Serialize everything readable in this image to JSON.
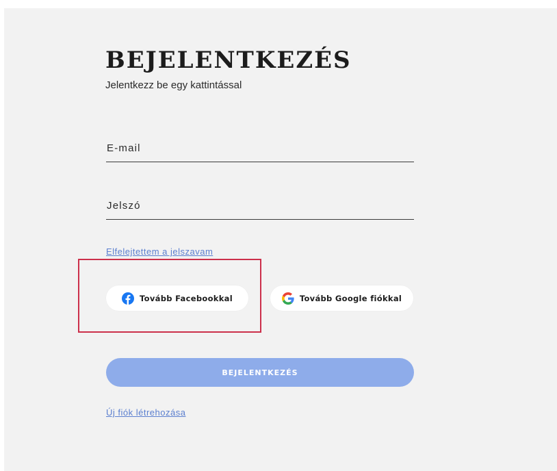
{
  "login": {
    "title": "BEJELENTKEZÉS",
    "subtitle": "Jelentkezz be egy kattintással",
    "email_placeholder": "E-mail",
    "password_placeholder": "Jelszó",
    "forgot_password": "Elfelejtettem a jelszavam",
    "facebook_button": "Tovább Facebookkal",
    "google_button": "Tovább Google fiókkal",
    "submit_button": "BEJELENTKEZÉS",
    "register_link": "Új fiók létrehozása"
  },
  "icons": {
    "facebook": "facebook-icon",
    "google": "google-icon"
  },
  "colors": {
    "background": "#f2f2f2",
    "accent": "#8eacea",
    "link": "#5b7fcf",
    "highlight": "#cc2f4a",
    "facebook_blue": "#1877f2"
  }
}
